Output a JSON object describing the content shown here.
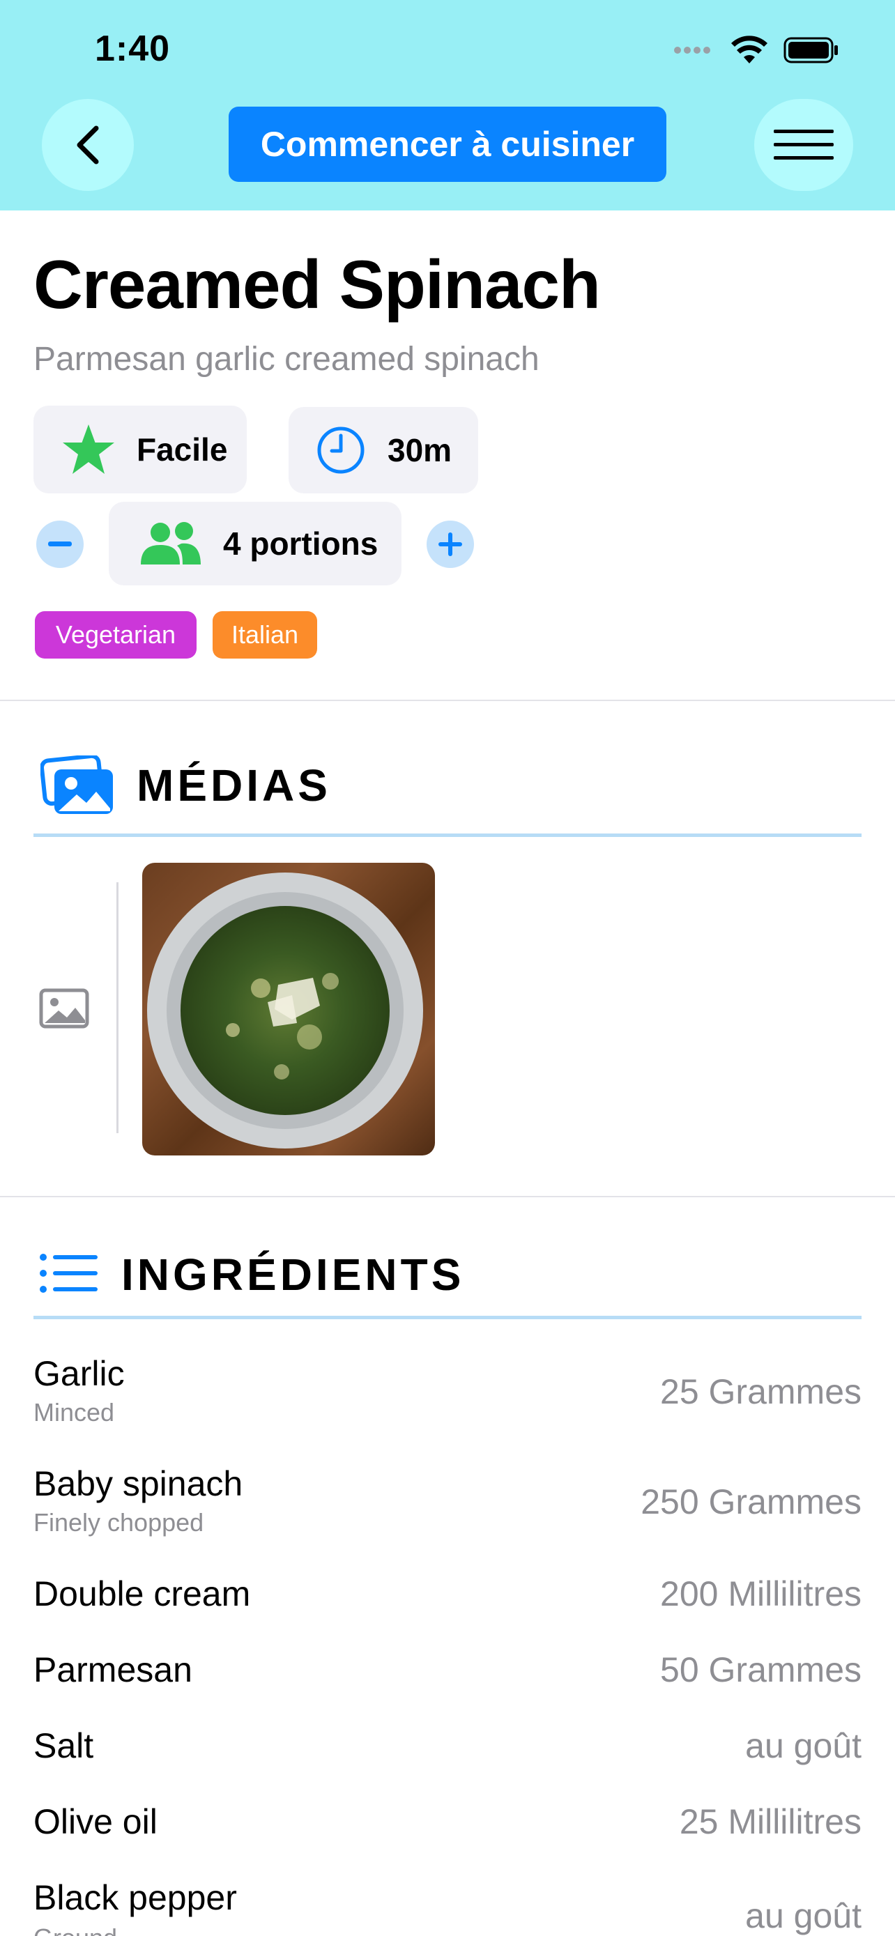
{
  "status": {
    "time": "1:40"
  },
  "header": {
    "cta_label": "Commencer à cuisiner"
  },
  "recipe": {
    "title": "Creamed Spinach",
    "subtitle": "Parmesan garlic creamed spinach",
    "difficulty": "Facile",
    "duration": "30m",
    "servings": "4 portions",
    "tags": [
      {
        "label": "Vegetarian",
        "color": "#cc37d9"
      },
      {
        "label": "Italian",
        "color": "#fc8c2a"
      }
    ]
  },
  "sections": {
    "media_title": "MÉDIAS",
    "ingredients_title": "INGRÉDIENTS"
  },
  "ingredients": [
    {
      "name": "Garlic",
      "note": "Minced",
      "qty": "25 Grammes"
    },
    {
      "name": "Baby spinach",
      "note": "Finely chopped",
      "qty": "250 Grammes"
    },
    {
      "name": "Double cream",
      "note": "",
      "qty": "200 Millilitres"
    },
    {
      "name": "Parmesan",
      "note": "",
      "qty": "50 Grammes"
    },
    {
      "name": "Salt",
      "note": "",
      "qty": "au goût"
    },
    {
      "name": "Olive oil",
      "note": "",
      "qty": "25 Millilitres"
    },
    {
      "name": "Black pepper",
      "note": "Ground",
      "qty": "au goût"
    }
  ],
  "colors": {
    "header_bg": "#98eff5",
    "accent": "#0a84ff",
    "star": "#34c759",
    "people": "#34c759"
  }
}
